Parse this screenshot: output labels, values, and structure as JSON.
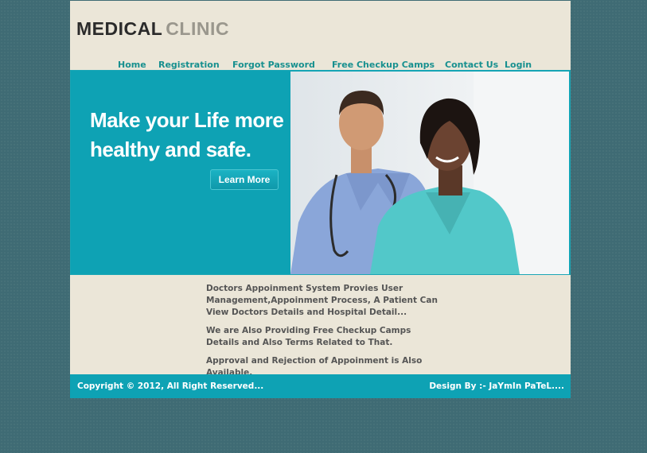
{
  "logo": {
    "word1": "MEDICAL",
    "word2": "CLINIC"
  },
  "nav": [
    {
      "label": "Home"
    },
    {
      "label": "Registration"
    },
    {
      "label": "Forgot Password"
    },
    {
      "label": "Free Checkup Camps"
    },
    {
      "label": "Contact Us"
    },
    {
      "label": "Login"
    }
  ],
  "hero": {
    "line1": "Make your Life more",
    "line2": "healthy and safe.",
    "button": "Learn More"
  },
  "content": {
    "p1": "Doctors Appoinment System Provies User Management,Appoinment Process, A Patient Can View Doctors Details and Hospital Detail...",
    "p2": " We are Also Providing Free Checkup Camps Details and Also Terms Related to That.",
    "p3": "Approval and Rejection of Appoinment is Also Available."
  },
  "footer": {
    "copyright": "Copyright © 2012, All Right Reserved...",
    "credit": "Design By :- JaYmIn PaTeL...."
  },
  "colors": {
    "accent": "#0ea2b4",
    "nav_link": "#17908f",
    "page_bg": "#ebe6d8",
    "outer_bg": "#3f6b74"
  }
}
